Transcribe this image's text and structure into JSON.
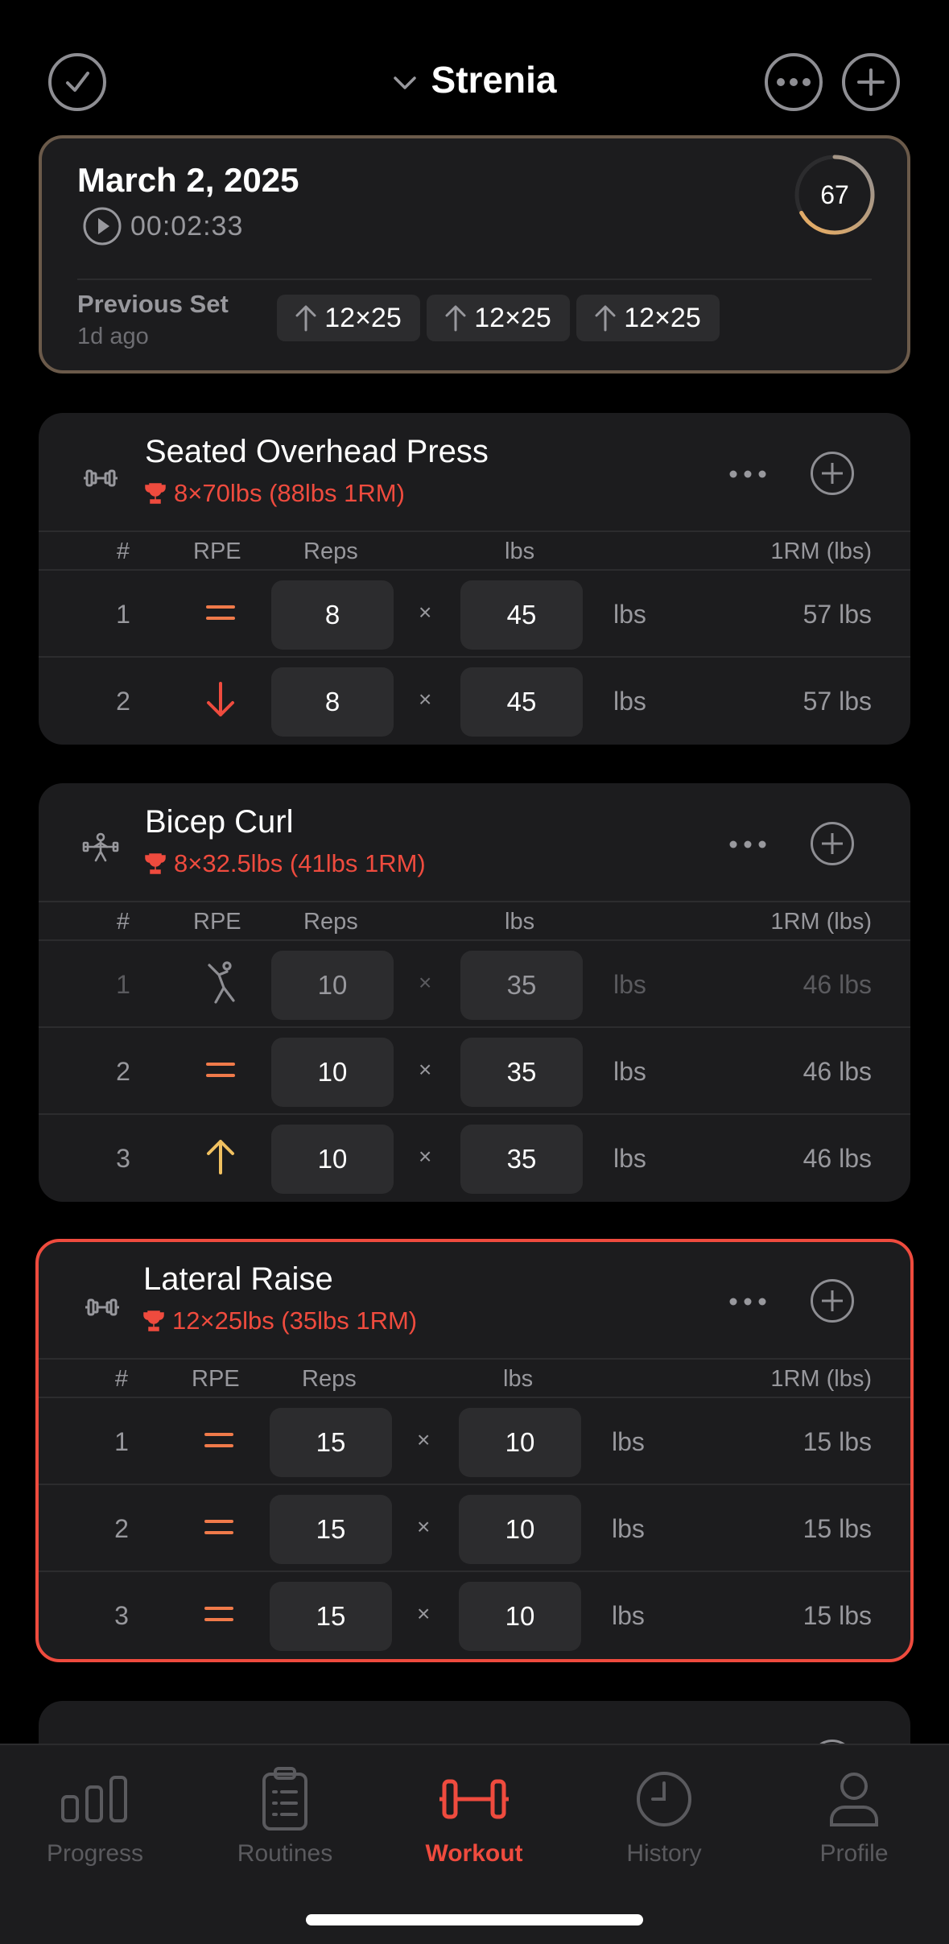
{
  "header": {
    "title": "Strenia",
    "finish_icon": "checkmark-circle-icon",
    "more_icon": "ellipsis-circle-icon",
    "add_icon": "plus-circle-icon"
  },
  "session": {
    "date": "March 2, 2025",
    "elapsed": "00:02:33",
    "score": "67",
    "score_fraction": 0.67,
    "previous_set_label": "Previous Set",
    "previous_set_age": "1d ago",
    "previous_sets": [
      "12×25",
      "12×25",
      "12×25"
    ]
  },
  "table_headers": {
    "num": "#",
    "rpe": "RPE",
    "reps": "Reps",
    "weight": "lbs",
    "orm": "1RM (lbs)"
  },
  "exercises": [
    {
      "name": "Seated Overhead Press",
      "icon": "dumbbell-icon",
      "record": "8×70lbs (88lbs 1RM)",
      "sets": [
        {
          "num": "1",
          "rpe": "equal",
          "reps": "8",
          "weight": "45",
          "unit": "lbs",
          "orm": "57 lbs"
        },
        {
          "num": "2",
          "rpe": "down",
          "reps": "8",
          "weight": "45",
          "unit": "lbs",
          "orm": "57 lbs"
        }
      ]
    },
    {
      "name": "Bicep Curl",
      "icon": "barbell-lifter-icon",
      "record": "8×32.5lbs (41lbs 1RM)",
      "sets": [
        {
          "num": "1",
          "rpe": "warmup",
          "reps": "10",
          "weight": "35",
          "unit": "lbs",
          "orm": "46 lbs"
        },
        {
          "num": "2",
          "rpe": "equal",
          "reps": "10",
          "weight": "35",
          "unit": "lbs",
          "orm": "46 lbs"
        },
        {
          "num": "3",
          "rpe": "up",
          "reps": "10",
          "weight": "35",
          "unit": "lbs",
          "orm": "46 lbs"
        }
      ]
    },
    {
      "name": "Lateral Raise",
      "icon": "dumbbell-icon",
      "record": "12×25lbs (35lbs 1RM)",
      "sets": [
        {
          "num": "1",
          "rpe": "equal",
          "reps": "15",
          "weight": "10",
          "unit": "lbs",
          "orm": "15 lbs"
        },
        {
          "num": "2",
          "rpe": "equal",
          "reps": "15",
          "weight": "10",
          "unit": "lbs",
          "orm": "15 lbs"
        },
        {
          "num": "3",
          "rpe": "equal",
          "reps": "15",
          "weight": "10",
          "unit": "lbs",
          "orm": "15 lbs"
        }
      ]
    }
  ],
  "tabs": [
    {
      "label": "Progress",
      "icon": "bar-chart-icon"
    },
    {
      "label": "Routines",
      "icon": "clipboard-list-icon"
    },
    {
      "label": "Workout",
      "icon": "dumbbell-icon",
      "active": true
    },
    {
      "label": "History",
      "icon": "clock-icon"
    },
    {
      "label": "Profile",
      "icon": "person-icon"
    }
  ],
  "colors": {
    "accent": "#ef4b3e",
    "rpe_equal": "#f07a4a",
    "rpe_down": "#ef4b3e",
    "rpe_up": "#f0c060",
    "ring_gradient": [
      "#f0b060",
      "#8e8e93"
    ]
  }
}
